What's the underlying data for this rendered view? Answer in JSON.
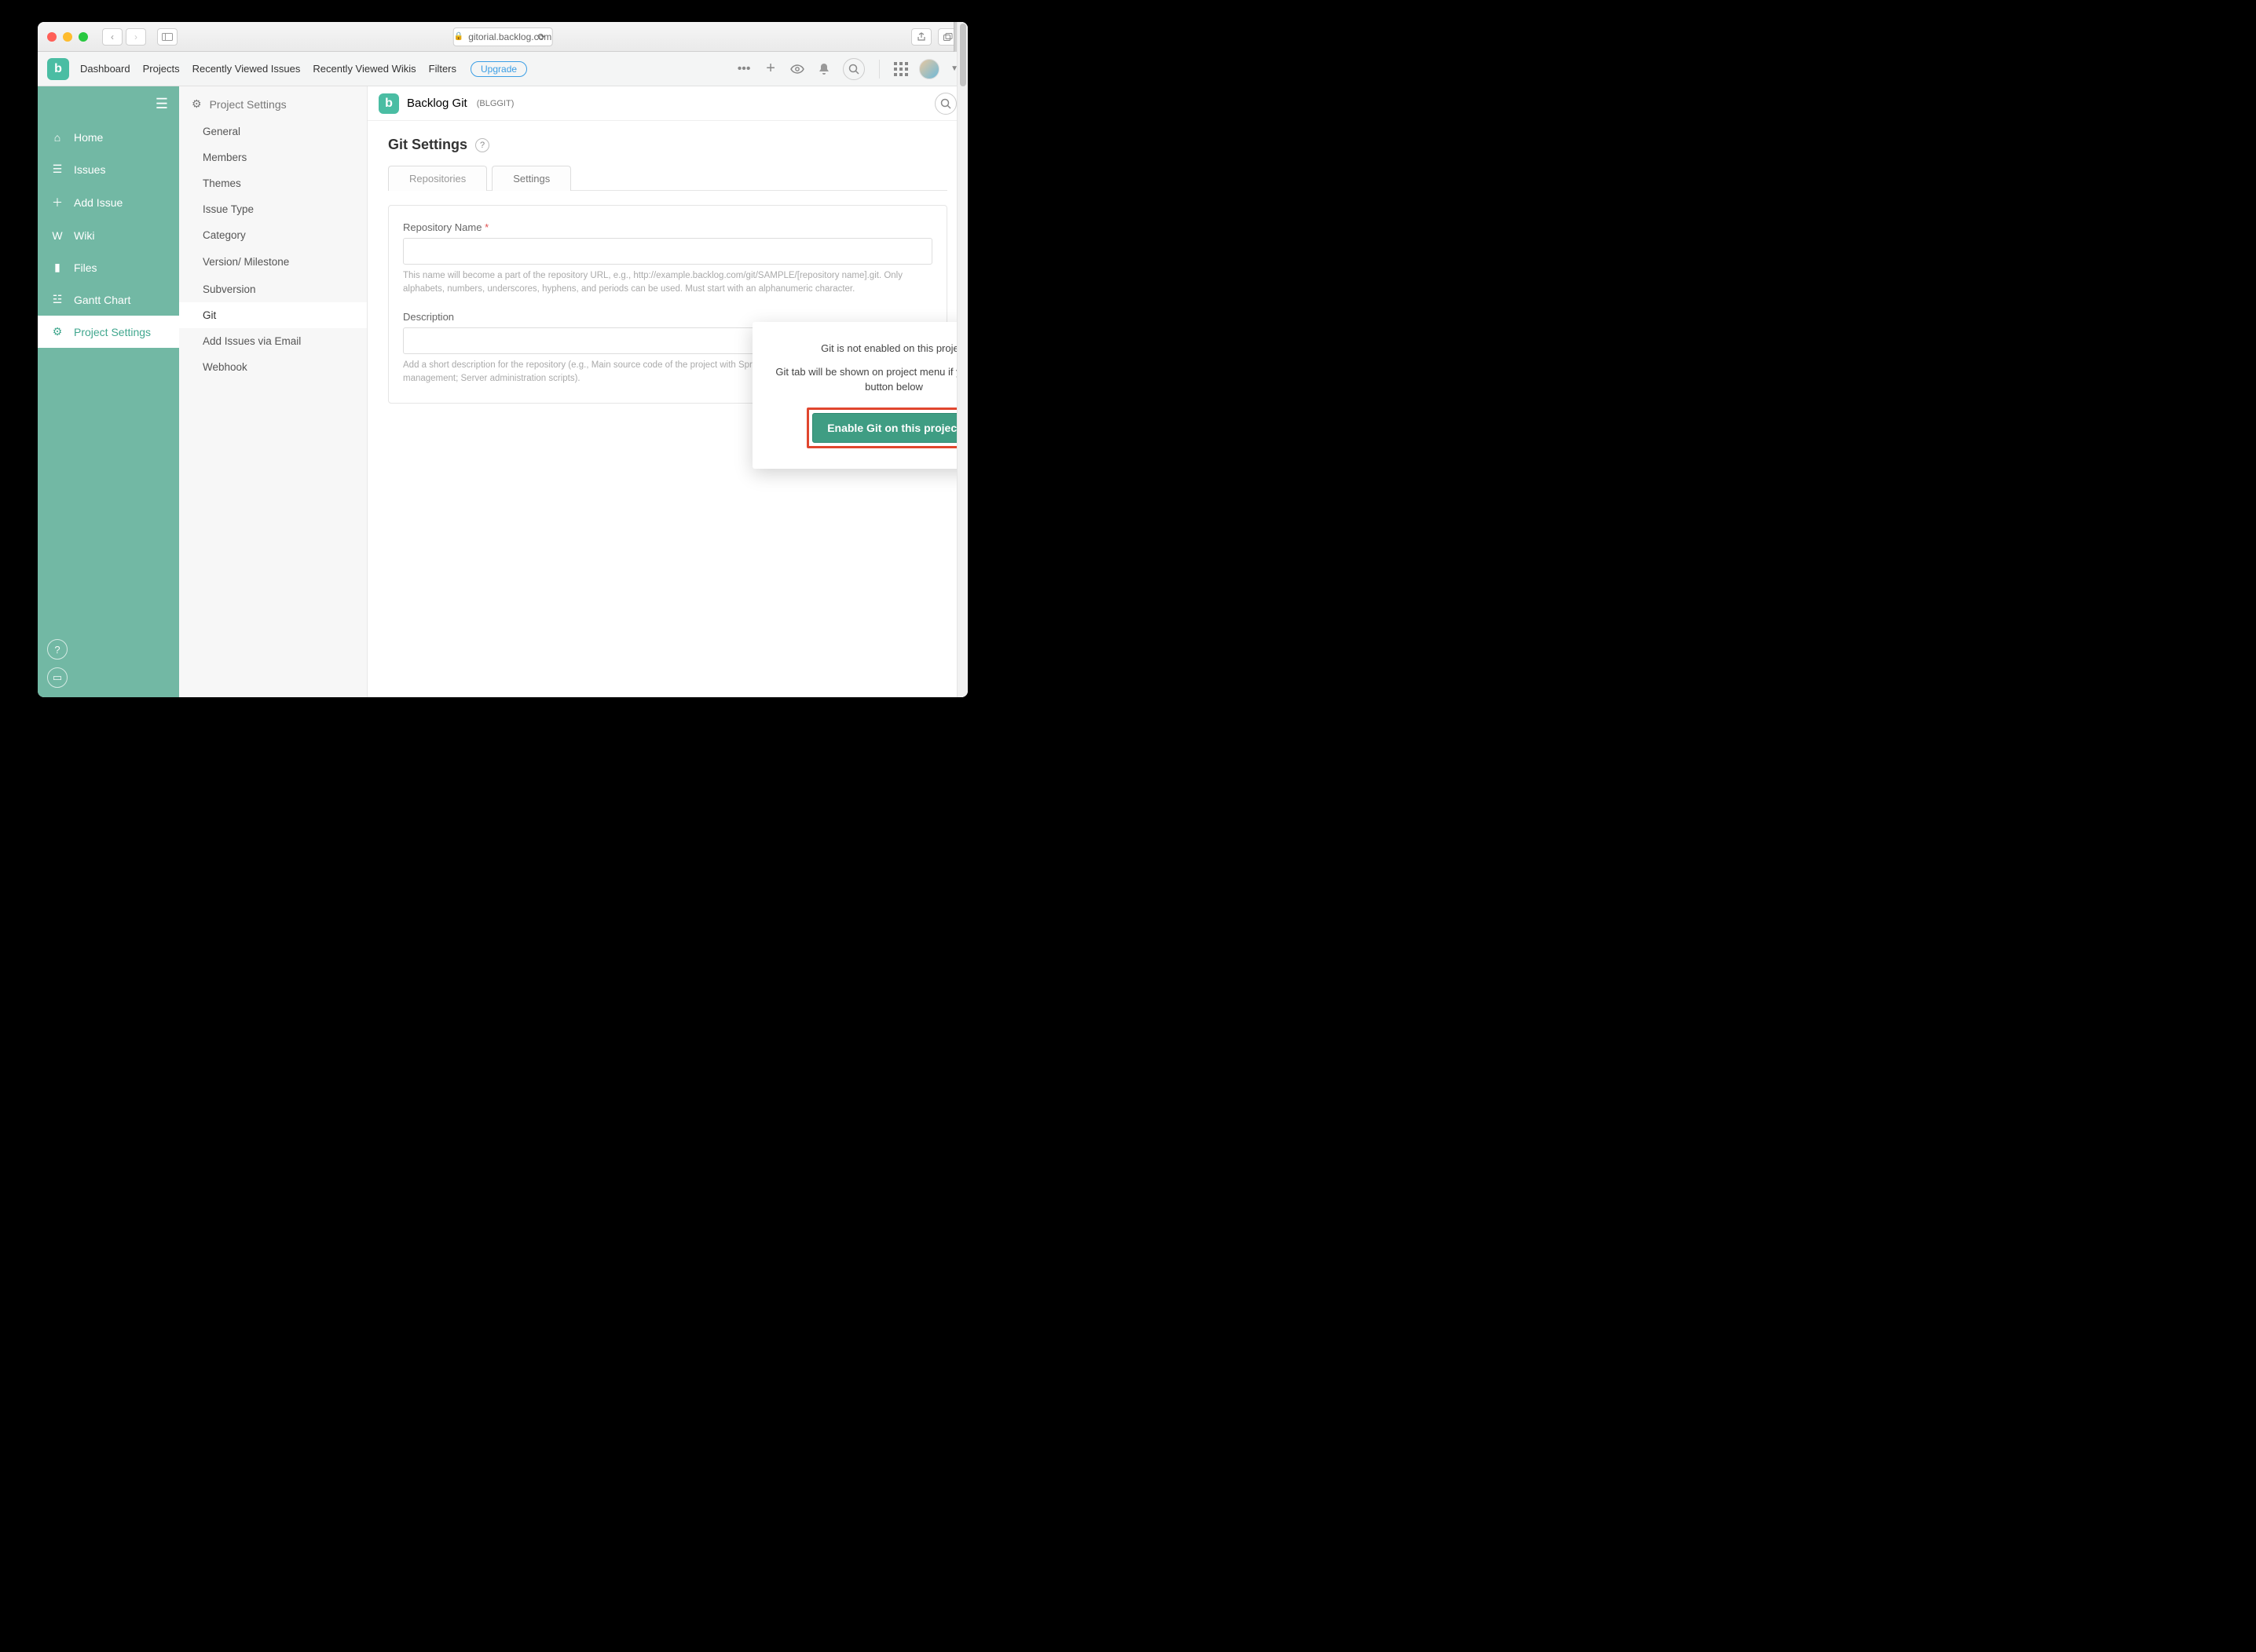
{
  "browser": {
    "url_host": "gitorial.backlog.com"
  },
  "header": {
    "nav": [
      "Dashboard",
      "Projects",
      "Recently Viewed Issues",
      "Recently Viewed Wikis",
      "Filters"
    ],
    "upgrade": "Upgrade"
  },
  "project": {
    "name": "Backlog Git",
    "code": "(BLGGIT)"
  },
  "sidebar": {
    "items": [
      {
        "label": "Home"
      },
      {
        "label": "Issues"
      },
      {
        "label": "Add Issue"
      },
      {
        "label": "Wiki"
      },
      {
        "label": "Files"
      },
      {
        "label": "Gantt Chart"
      },
      {
        "label": "Project Settings"
      }
    ]
  },
  "subnav": {
    "heading": "Project Settings",
    "items": [
      "General",
      "Members",
      "Themes",
      "Issue Type",
      "Category",
      "Version/ Milestone",
      "Subversion",
      "Git",
      "Add Issues via Email",
      "Webhook"
    ]
  },
  "page": {
    "title": "Git Settings",
    "tabs": [
      "Repositories",
      "Settings"
    ]
  },
  "form": {
    "repo_label": "Repository Name",
    "repo_hint": "This name will become a part of the repository URL, e.g., http://example.backlog.com/git/SAMPLE/[repository name].git. Only alphabets, numbers, underscores, hyphens, and periods can be used. Must start with an alphanumeric character.",
    "desc_label": "Description",
    "desc_hint": "Add a short description for the repository (e.g., Main source code of the project with Spring framework as base; Release management; Server administration scripts)."
  },
  "popover": {
    "line1": "Git is not enabled on this project",
    "line2": "Git tab will be shown on project menu if you click the button below",
    "button": "Enable Git on this project"
  }
}
